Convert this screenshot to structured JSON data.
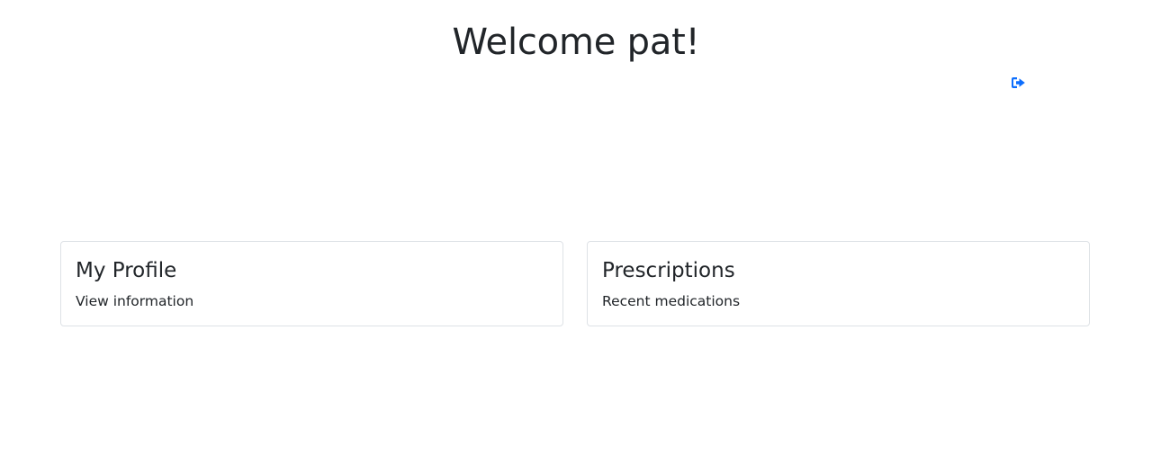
{
  "header": {
    "title": "Welcome pat!"
  },
  "logout": {
    "icon": "sign-out-icon",
    "color": "#0d6efd"
  },
  "cards": [
    {
      "title": "My Profile",
      "text": "View information"
    },
    {
      "title": "Prescriptions",
      "text": "Recent medications"
    }
  ],
  "colors": {
    "text": "#212529",
    "card_border": "#dee2e6",
    "accent": "#0d6efd"
  }
}
